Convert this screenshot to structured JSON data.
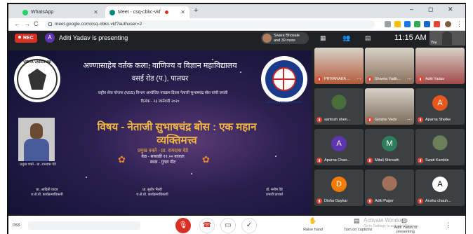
{
  "browser": {
    "tabs": [
      {
        "label": "WhatsApp",
        "favicon_color": "#25d366",
        "active": false
      },
      {
        "label": "Meet - csq-cbkc-vkf",
        "favicon_color": "#00897b",
        "active": true
      }
    ],
    "new_tab": "+",
    "window_controls": [
      "–",
      "◻",
      "✕"
    ],
    "nav": {
      "back": "←",
      "forward": "→",
      "reload": "C"
    },
    "url": "meet.google.com/csq-cbkc-vkf?authuser=2"
  },
  "meet_header": {
    "rec_label": "REC",
    "presenter_initial": "A",
    "presenter_text": "Aditi Yadav is presenting",
    "join_notice": {
      "name": "Swara Bhosale",
      "action": "and 39 more"
    },
    "time": "11:15 AM",
    "self_label": "You"
  },
  "slide": {
    "line1": "अण्णासाहेब वर्तक कला, वाणिज्य व विज्ञान महाविद्यालय",
    "line2": "वसई रोड (प.), पालघर",
    "line3": "राष्ट्रीय सेवा योजना (NSS) विभाग आयोजित पराक्रम दिवस नेताजी सुभाषचंद्र बोस यांची जयंती",
    "line4": "दिनांक - २३ जानेवारी २०२०",
    "subject_line1": "विषय - नेताजी सुभाषचंद्र बोस : एक महान",
    "subject_line2": "व्यक्तिमत्त्व",
    "chief_guest_label": "प्रमुख वक्ते - प्रा. रामदास वेडे",
    "chief_guest_time": "वेळ - सकाळी ११.०० वाजता",
    "chief_guest_place": "स्थळ - गुगल मीट",
    "speaker_caption": "प्रमुख वक्ते - प्रा. रामदास वेडे",
    "left_logo_text": "VIDYA VARDHINI",
    "right_logo_text": "NATIONAL SERVICE SCHEME",
    "signatures": [
      {
        "name": "प्रा. आदिती यादव",
        "role": "रा.से.यो. कार्यक्रमाधिकारी"
      },
      {
        "name": "प्रा. सुधीर भैरवी",
        "role": "रा.से.यो. कार्यक्रमाधिकारी"
      },
      {
        "name": "डॉ. मनीष वेडे",
        "role": "प्रभारी प्राचार्य"
      }
    ]
  },
  "participants": [
    {
      "name": "PRIYANAKA ...",
      "type": "video",
      "color": "#b45a3a"
    },
    {
      "name": "Shweta Yadh...",
      "type": "video",
      "color": "#8a6f5a"
    },
    {
      "name": "Aditi Yadav",
      "type": "video",
      "color": "#a04a4a"
    },
    {
      "name": "santosh shen...",
      "type": "photo",
      "color": "#4a6e3a"
    },
    {
      "name": "Girishe Vede",
      "type": "video",
      "color": "#7a6a5a"
    },
    {
      "name": "Aparna Shelke",
      "type": "letter",
      "letter": "A",
      "color": "#e8571e"
    },
    {
      "name": "Aparna Chan...",
      "type": "letter",
      "letter": "A",
      "color": "#5e35b1"
    },
    {
      "name": "Mitali Shirsath",
      "type": "letter",
      "letter": "M",
      "color": "#2e7d5b"
    },
    {
      "name": "Swati Kamble",
      "type": "photo",
      "color": "#6a7f5a"
    },
    {
      "name": "Disha Gaykar",
      "type": "letter",
      "letter": "D",
      "color": "#f57c00"
    },
    {
      "name": "Aditi Pager",
      "type": "photo",
      "color": "#a0705a"
    },
    {
      "name": "Anshu chauh...",
      "type": "letter",
      "letter": "A",
      "color": "#ffffff"
    }
  ],
  "bottom": {
    "meeting_name": "nss",
    "raise_hand": "Raise hand",
    "captions": "Turn on captions",
    "present": "Aditi Yadav is presenting",
    "activate_title": "Activate Windows",
    "activate_sub": "Go to Settings to activate Windows."
  }
}
